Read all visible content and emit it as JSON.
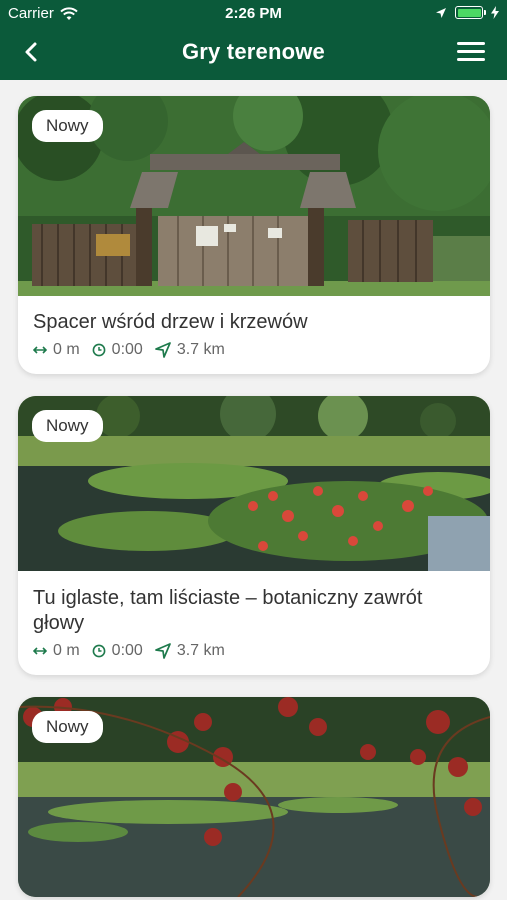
{
  "status_bar": {
    "carrier": "Carrier",
    "time": "2:26 PM"
  },
  "nav": {
    "title": "Gry terenowe"
  },
  "colors": {
    "brand": "#0b5a3a",
    "icon_green": "#1e7a4c"
  },
  "cards": [
    {
      "badge": "Nowy",
      "title": "Spacer wśród drzew i krzewów",
      "distance": "0 m",
      "duration": "0:00",
      "route": "3.7 km"
    },
    {
      "badge": "Nowy",
      "title": "Tu iglaste, tam liściaste – botaniczny zawrót głowy",
      "distance": "0 m",
      "duration": "0:00",
      "route": "3.7 km"
    },
    {
      "badge": "Nowy"
    }
  ]
}
